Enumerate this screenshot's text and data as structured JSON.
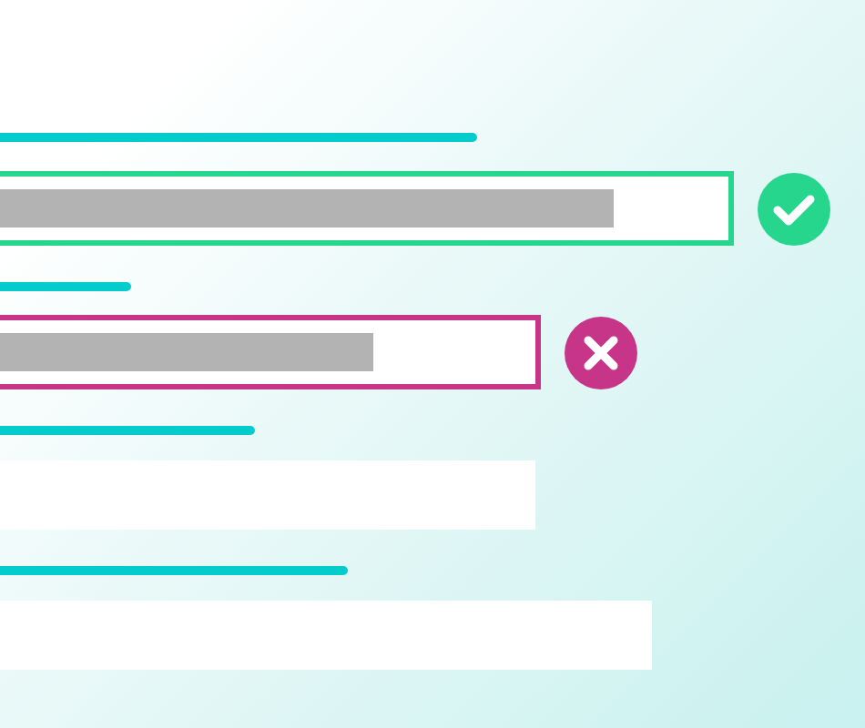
{
  "form": {
    "fields": [
      {
        "kind": "valid"
      },
      {
        "kind": "invalid"
      },
      {
        "kind": "empty"
      },
      {
        "kind": "empty"
      }
    ]
  }
}
